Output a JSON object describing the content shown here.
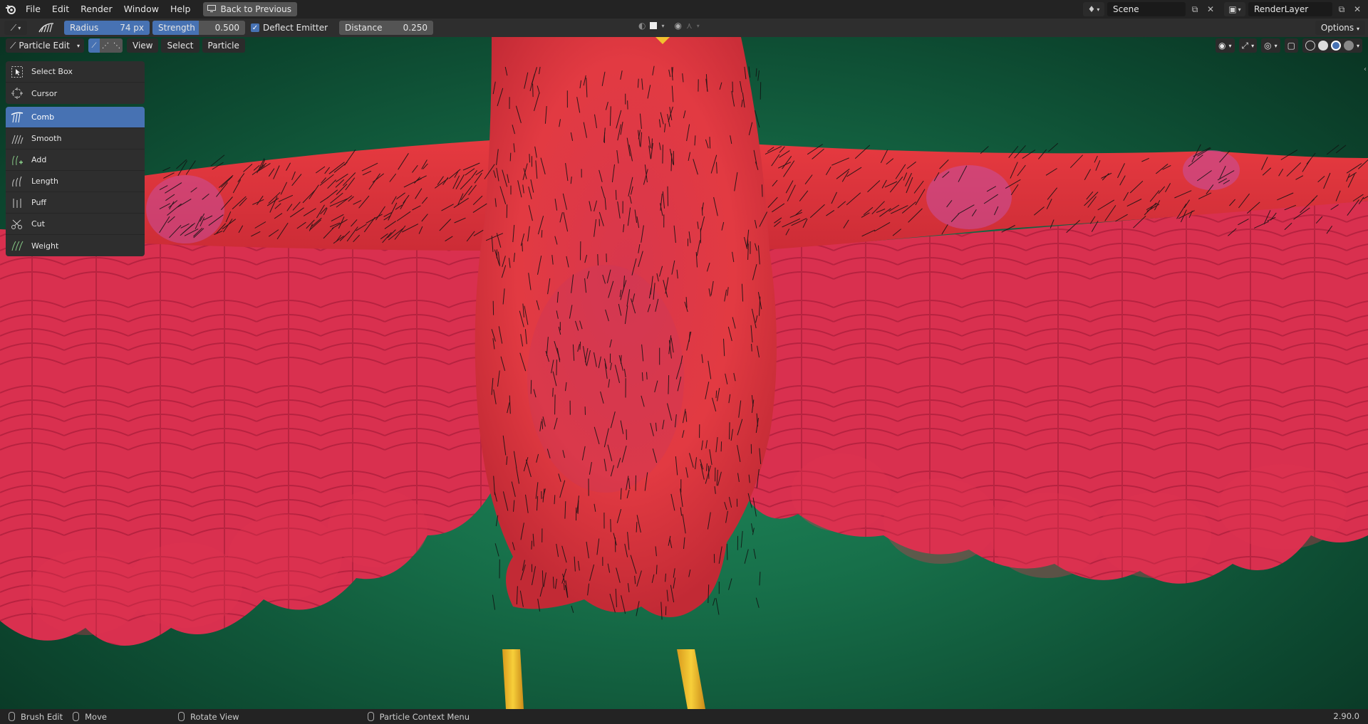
{
  "topbar": {
    "menus": [
      "File",
      "Edit",
      "Render",
      "Window",
      "Help"
    ],
    "back_button": "Back to Previous",
    "scene": "Scene",
    "render_layer": "RenderLayer"
  },
  "toolbar": {
    "radius_label": "Radius",
    "radius_value": "74 px",
    "strength_label": "Strength",
    "strength_value": "0.500",
    "strength_fraction": 0.5,
    "deflect_label": "Deflect Emitter",
    "deflect_checked": true,
    "distance_label": "Distance",
    "distance_value": "0.250",
    "options_label": "Options"
  },
  "viewport_header": {
    "mode": "Particle Edit",
    "menus": [
      "View",
      "Select",
      "Particle"
    ]
  },
  "tools": {
    "selection": [
      {
        "label": "Select Box",
        "icon": "select-box-icon"
      },
      {
        "label": "Cursor",
        "icon": "cursor-icon"
      }
    ],
    "brushes": [
      {
        "label": "Comb",
        "icon": "comb-icon",
        "active": true
      },
      {
        "label": "Smooth",
        "icon": "smooth-icon"
      },
      {
        "label": "Add",
        "icon": "add-icon"
      },
      {
        "label": "Length",
        "icon": "length-icon"
      },
      {
        "label": "Puff",
        "icon": "puff-icon"
      },
      {
        "label": "Cut",
        "icon": "cut-icon"
      },
      {
        "label": "Weight",
        "icon": "weight-icon"
      }
    ]
  },
  "statusbar": {
    "brush_edit": "Brush Edit",
    "move": "Move",
    "rotate_view": "Rotate View",
    "context_menu": "Particle Context Menu",
    "version": "2.90.0"
  },
  "colors": {
    "accent": "#4772b3",
    "background_green": "#1f8a5c",
    "bird_red": "#e8363f",
    "feather_pink": "#d92e52",
    "leg_yellow": "#f2c12e"
  }
}
